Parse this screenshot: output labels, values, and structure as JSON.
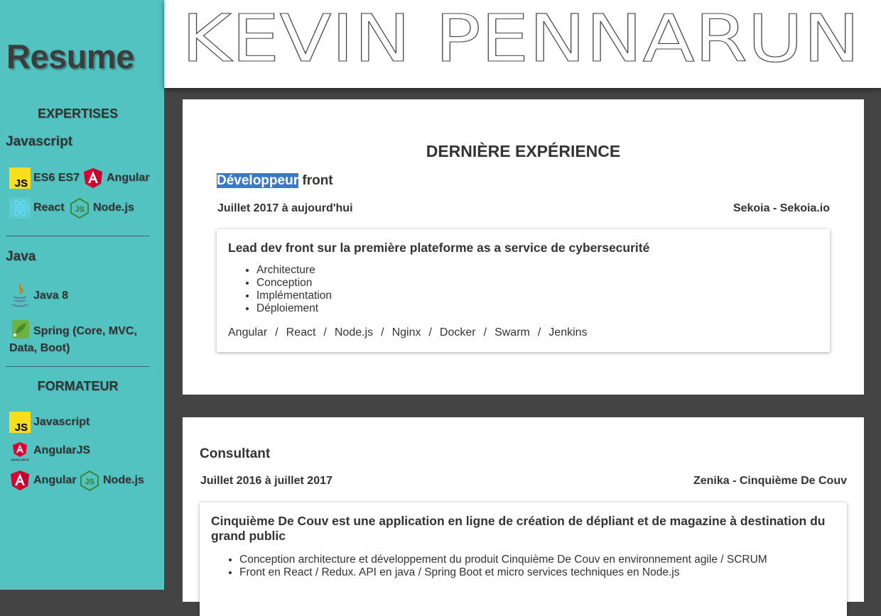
{
  "sidebar": {
    "title": "Resume",
    "expertises_title": "EXPERTISES",
    "javascript_group": "Javascript",
    "javascript_skills": [
      "ES6 ES7",
      "Angular",
      "React",
      "Node.js"
    ],
    "java_group": "Java",
    "java_skills": [
      "Java 8",
      "Spring (Core, MVC, Data, Boot)"
    ],
    "formateur_title": "FORMATEUR",
    "formateur_skills": [
      "Javascript",
      "AngularJS",
      "Angular",
      "Node.js"
    ]
  },
  "header": {
    "name": "KEVIN PENNARUN"
  },
  "experience1": {
    "section_title": "DERNIÈRE EXPÉRIENCE",
    "title_highlighted": "Développeur",
    "title_rest": " front",
    "date": "Juillet 2017 à aujourd'hui",
    "company": "Sekoia - Sekoia.io",
    "lead": "Lead dev front sur la première plateforme as a service de cybersecurité",
    "bullets": [
      "Architecture",
      "Conception",
      "Implémentation",
      "Déploiement"
    ],
    "tech": [
      "Angular",
      "React",
      "Node.js",
      "Nginx",
      "Docker",
      "Swarm",
      "Jenkins"
    ],
    "tech_separator": "/"
  },
  "experience2": {
    "title": "Consultant",
    "date": "Juillet 2016 à juillet 2017",
    "company": "Zenika - Cinquième De Couv",
    "lead": "Cinquième De Couv est une application en ligne de création de dépliant et de magazine à destination du grand public",
    "bullets": [
      "Conception architecture et développement du produit Cinquième De Couv en environnement agile / SCRUM",
      "Front en React / Redux. API en java / Spring Boot et micro services techniques en Node.js"
    ]
  },
  "colors": {
    "sidebar_bg": "#52c3c1",
    "page_bg": "#444444",
    "selection": "#3b78c9"
  },
  "icons": {
    "js": "JS",
    "angularjs_caption": "ANGULARJS"
  }
}
